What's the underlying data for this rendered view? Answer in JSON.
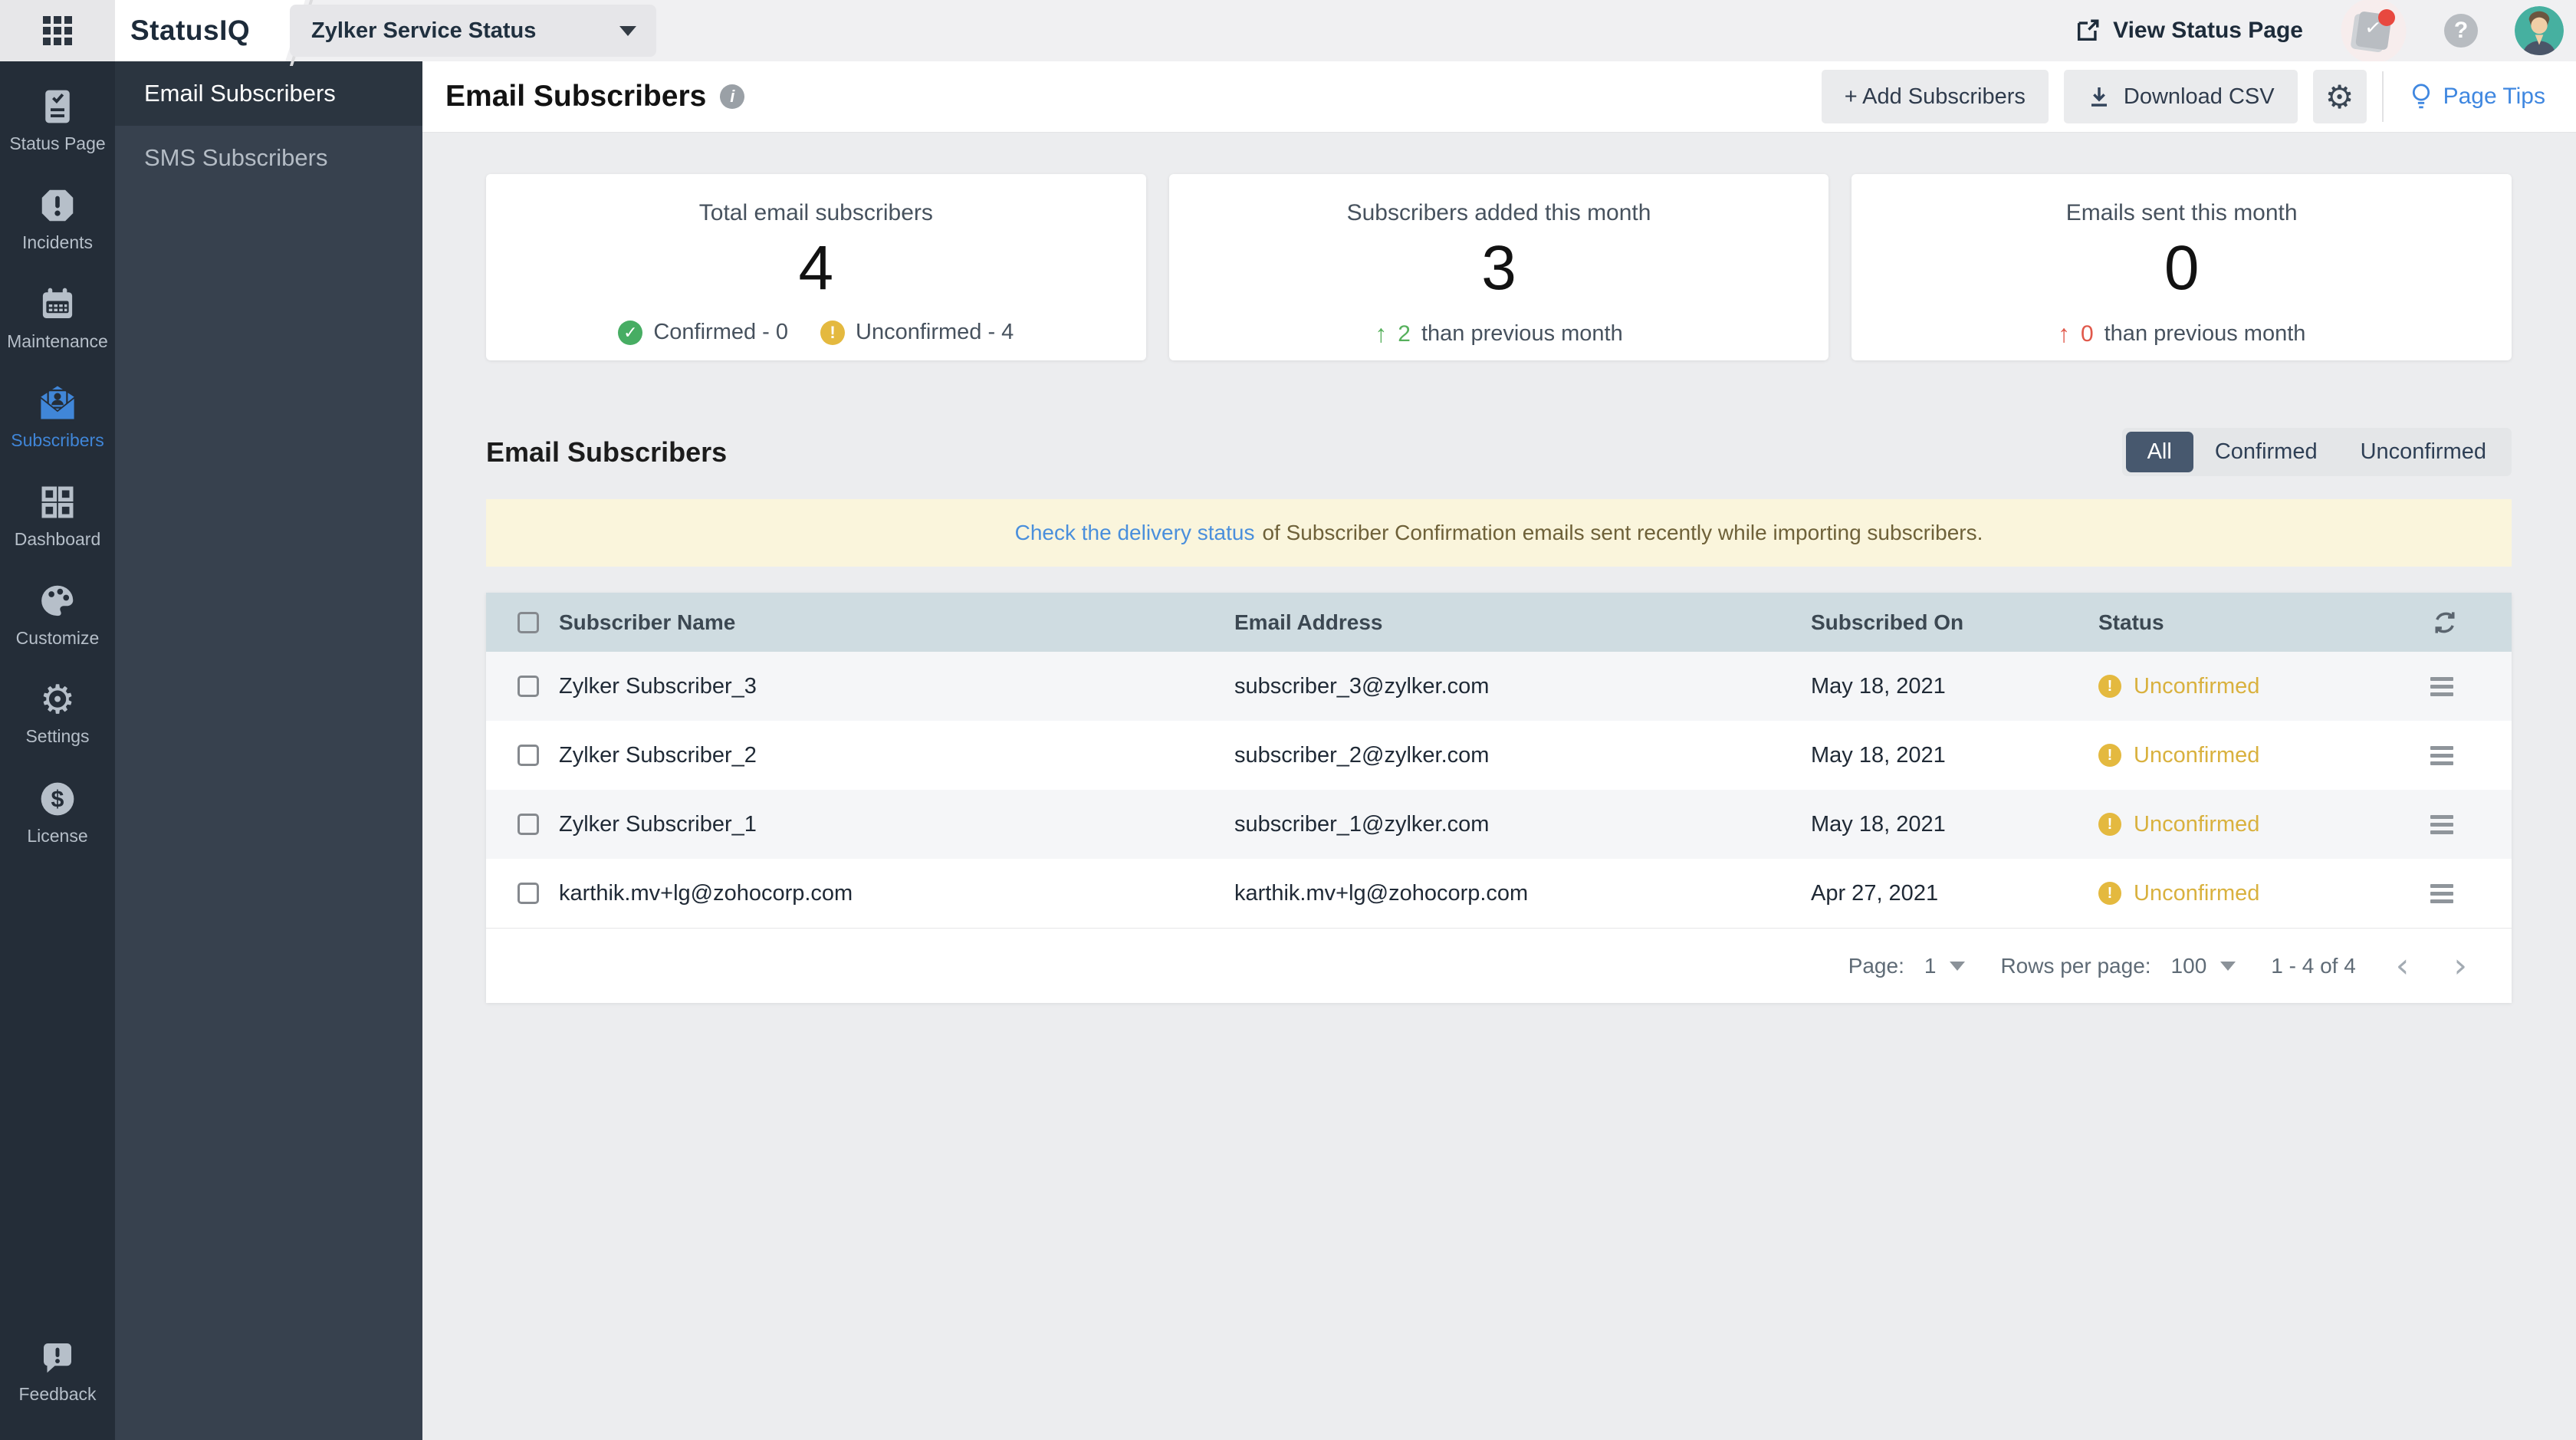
{
  "topbar": {
    "brand": "StatusIQ",
    "portal_selector": "Zylker Service Status",
    "view_status_page_label": "View Status Page"
  },
  "sidebar": {
    "items": [
      {
        "label": "Status Page",
        "icon": "status-page"
      },
      {
        "label": "Incidents",
        "icon": "incidents"
      },
      {
        "label": "Maintenance",
        "icon": "maintenance"
      },
      {
        "label": "Subscribers",
        "icon": "subscribers",
        "active": true
      },
      {
        "label": "Dashboard",
        "icon": "dashboard"
      },
      {
        "label": "Customize",
        "icon": "customize"
      },
      {
        "label": "Settings",
        "icon": "settings"
      },
      {
        "label": "License",
        "icon": "license"
      }
    ],
    "feedback_label": "Feedback"
  },
  "subnav": {
    "items": [
      {
        "label": "Email Subscribers",
        "active": true
      },
      {
        "label": "SMS Subscribers",
        "active": false
      }
    ]
  },
  "header": {
    "title": "Email Subscribers",
    "add_subscribers_label": "+ Add Subscribers",
    "download_csv_label": "Download CSV",
    "page_tips_label": "Page Tips"
  },
  "stats": {
    "cards": [
      {
        "title": "Total email subscribers",
        "value": "4",
        "confirmed_label": "Confirmed - 0",
        "unconfirmed_label": "Unconfirmed - 4"
      },
      {
        "title": "Subscribers added this month",
        "value": "3",
        "delta_arrow": "↑",
        "delta_value": "2",
        "delta_suffix": "than previous month",
        "delta_color": "green"
      },
      {
        "title": "Emails sent this month",
        "value": "0",
        "delta_arrow": "↑",
        "delta_value": "0",
        "delta_suffix": "than previous month",
        "delta_color": "red"
      }
    ]
  },
  "section": {
    "title": "Email Subscribers",
    "filters": {
      "all": "All",
      "confirmed": "Confirmed",
      "unconfirmed": "Unconfirmed"
    },
    "active_filter": "All",
    "banner_link": "Check the delivery status",
    "banner_text": "of Subscriber Confirmation emails sent recently while importing subscribers."
  },
  "table": {
    "columns": {
      "name": "Subscriber Name",
      "email": "Email Address",
      "date": "Subscribed On",
      "status": "Status"
    },
    "rows": [
      {
        "name": "Zylker Subscriber_3",
        "email": "subscriber_3@zylker.com",
        "date": "May 18, 2021",
        "status": "Unconfirmed"
      },
      {
        "name": "Zylker Subscriber_2",
        "email": "subscriber_2@zylker.com",
        "date": "May 18, 2021",
        "status": "Unconfirmed"
      },
      {
        "name": "Zylker Subscriber_1",
        "email": "subscriber_1@zylker.com",
        "date": "May 18, 2021",
        "status": "Unconfirmed"
      },
      {
        "name": "karthik.mv+lg@zohocorp.com",
        "email": "karthik.mv+lg@zohocorp.com",
        "date": "Apr 27, 2021",
        "status": "Unconfirmed"
      }
    ],
    "pagination": {
      "page_label": "Page:",
      "page_value": "1",
      "rows_label": "Rows per page:",
      "rows_value": "100",
      "range": "1 - 4 of 4"
    }
  },
  "colors": {
    "accent_blue": "#4086d8",
    "link_blue": "#4a8fdc",
    "warn_amber": "#e4b93f",
    "success_green": "#47ad63",
    "danger_red": "#e0584a",
    "sidebar_dark": "#242d38",
    "table_header": "#cfdce1"
  }
}
